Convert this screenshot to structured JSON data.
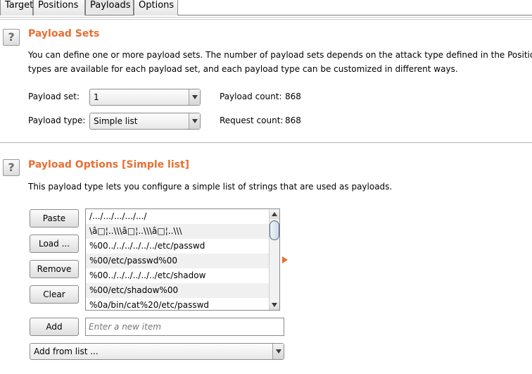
{
  "tabs": [
    {
      "label": "Target"
    },
    {
      "label": "Positions"
    },
    {
      "label": "Payloads"
    },
    {
      "label": "Options"
    }
  ],
  "payload_sets": {
    "title": "Payload Sets",
    "description_line1": "You can define one or more payload sets. The number of payload sets depends on the attack type defined in the Positions ta",
    "description_line2": "types are available for each payload set, and each payload type can be customized in different ways.",
    "set_label": "Payload set:",
    "set_value": "1",
    "type_label": "Payload type:",
    "type_value": "Simple list",
    "payload_count_label": "Payload count:",
    "payload_count_value": "868",
    "request_count_label": "Request count:",
    "request_count_value": "868"
  },
  "payload_options": {
    "title": "Payload Options [Simple list]",
    "description": "This payload type lets you configure a simple list of strings that are used as payloads.",
    "buttons": {
      "paste": "Paste",
      "load": "Load ...",
      "remove": "Remove",
      "clear": "Clear",
      "add": "Add"
    },
    "list_items": [
      "/.../.../.../.../.../",
      "\\â□¦..\\\\\\â□¦..\\\\\\â□¦..\\\\\\",
      "%00../../../../../../etc/passwd",
      "%00/etc/passwd%00",
      "%00../../../../../../etc/shadow",
      "%00/etc/shadow%00",
      "%0a/bin/cat%20/etc/passwd"
    ],
    "new_item_placeholder": "Enter a new item",
    "add_from_list_label": "Add from list ..."
  },
  "colors": {
    "accent": "#e76f33"
  }
}
